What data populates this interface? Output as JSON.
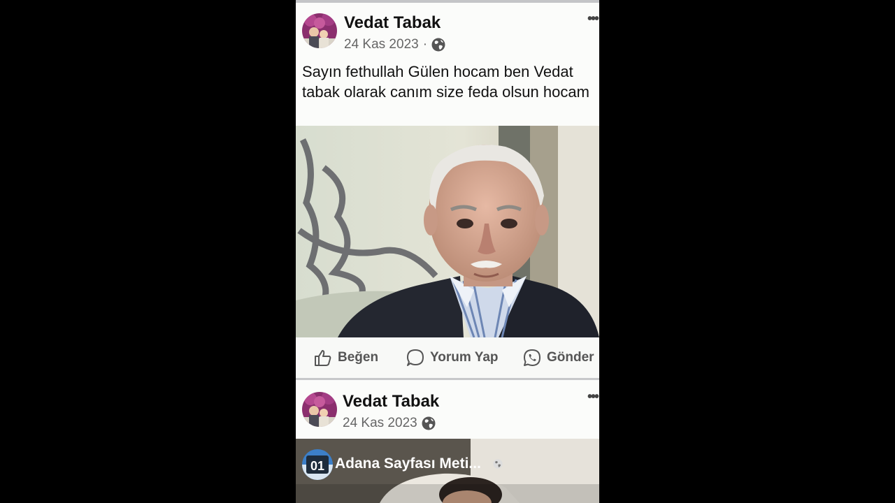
{
  "posts": [
    {
      "author": "Vedat Tabak",
      "date": "24 Kas 2023",
      "separator": "·",
      "text": "Sayın fethullah Gülen hocam ben Vedat tabak olarak canım size feda olsun hocam",
      "more": "•••"
    },
    {
      "author": "Vedat Tabak",
      "date": "24 Kas 2023",
      "more": "•••",
      "shared_page": "Adana Sayfası Meti...",
      "shared_badge": "01"
    }
  ],
  "actions": {
    "like": "Beğen",
    "comment": "Yorum Yap",
    "send": "Gönder"
  }
}
